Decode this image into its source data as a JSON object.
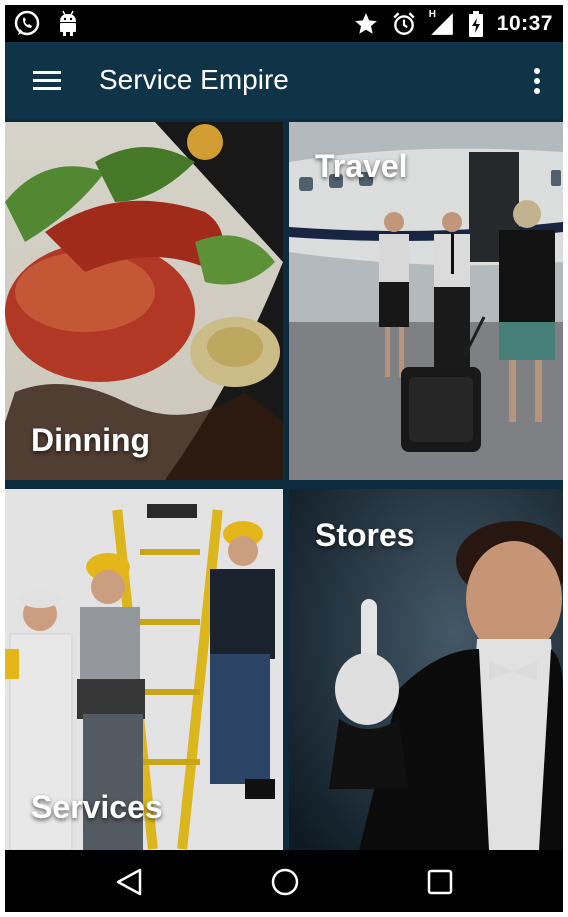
{
  "status_bar": {
    "time": "10:37",
    "network_label": "H",
    "left_icons": [
      "whatsapp-icon",
      "android-icon"
    ],
    "right_icons": [
      "star-icon",
      "alarm-icon",
      "signal-icon",
      "battery-charging-icon"
    ]
  },
  "app_bar": {
    "title": "Service Empire",
    "menu_icon": "hamburger-menu-icon",
    "overflow_icon": "more-vertical-icon"
  },
  "tiles": [
    {
      "label": "Dinning"
    },
    {
      "label": "Travel"
    },
    {
      "label": "Services"
    },
    {
      "label": "Stores"
    }
  ],
  "nav_bar": {
    "icons": [
      "back-icon",
      "home-icon",
      "recents-icon"
    ]
  },
  "colors": {
    "app_bar": "#0f3347",
    "grid_background": "#0c2b3c",
    "status_bar": "#000000"
  }
}
